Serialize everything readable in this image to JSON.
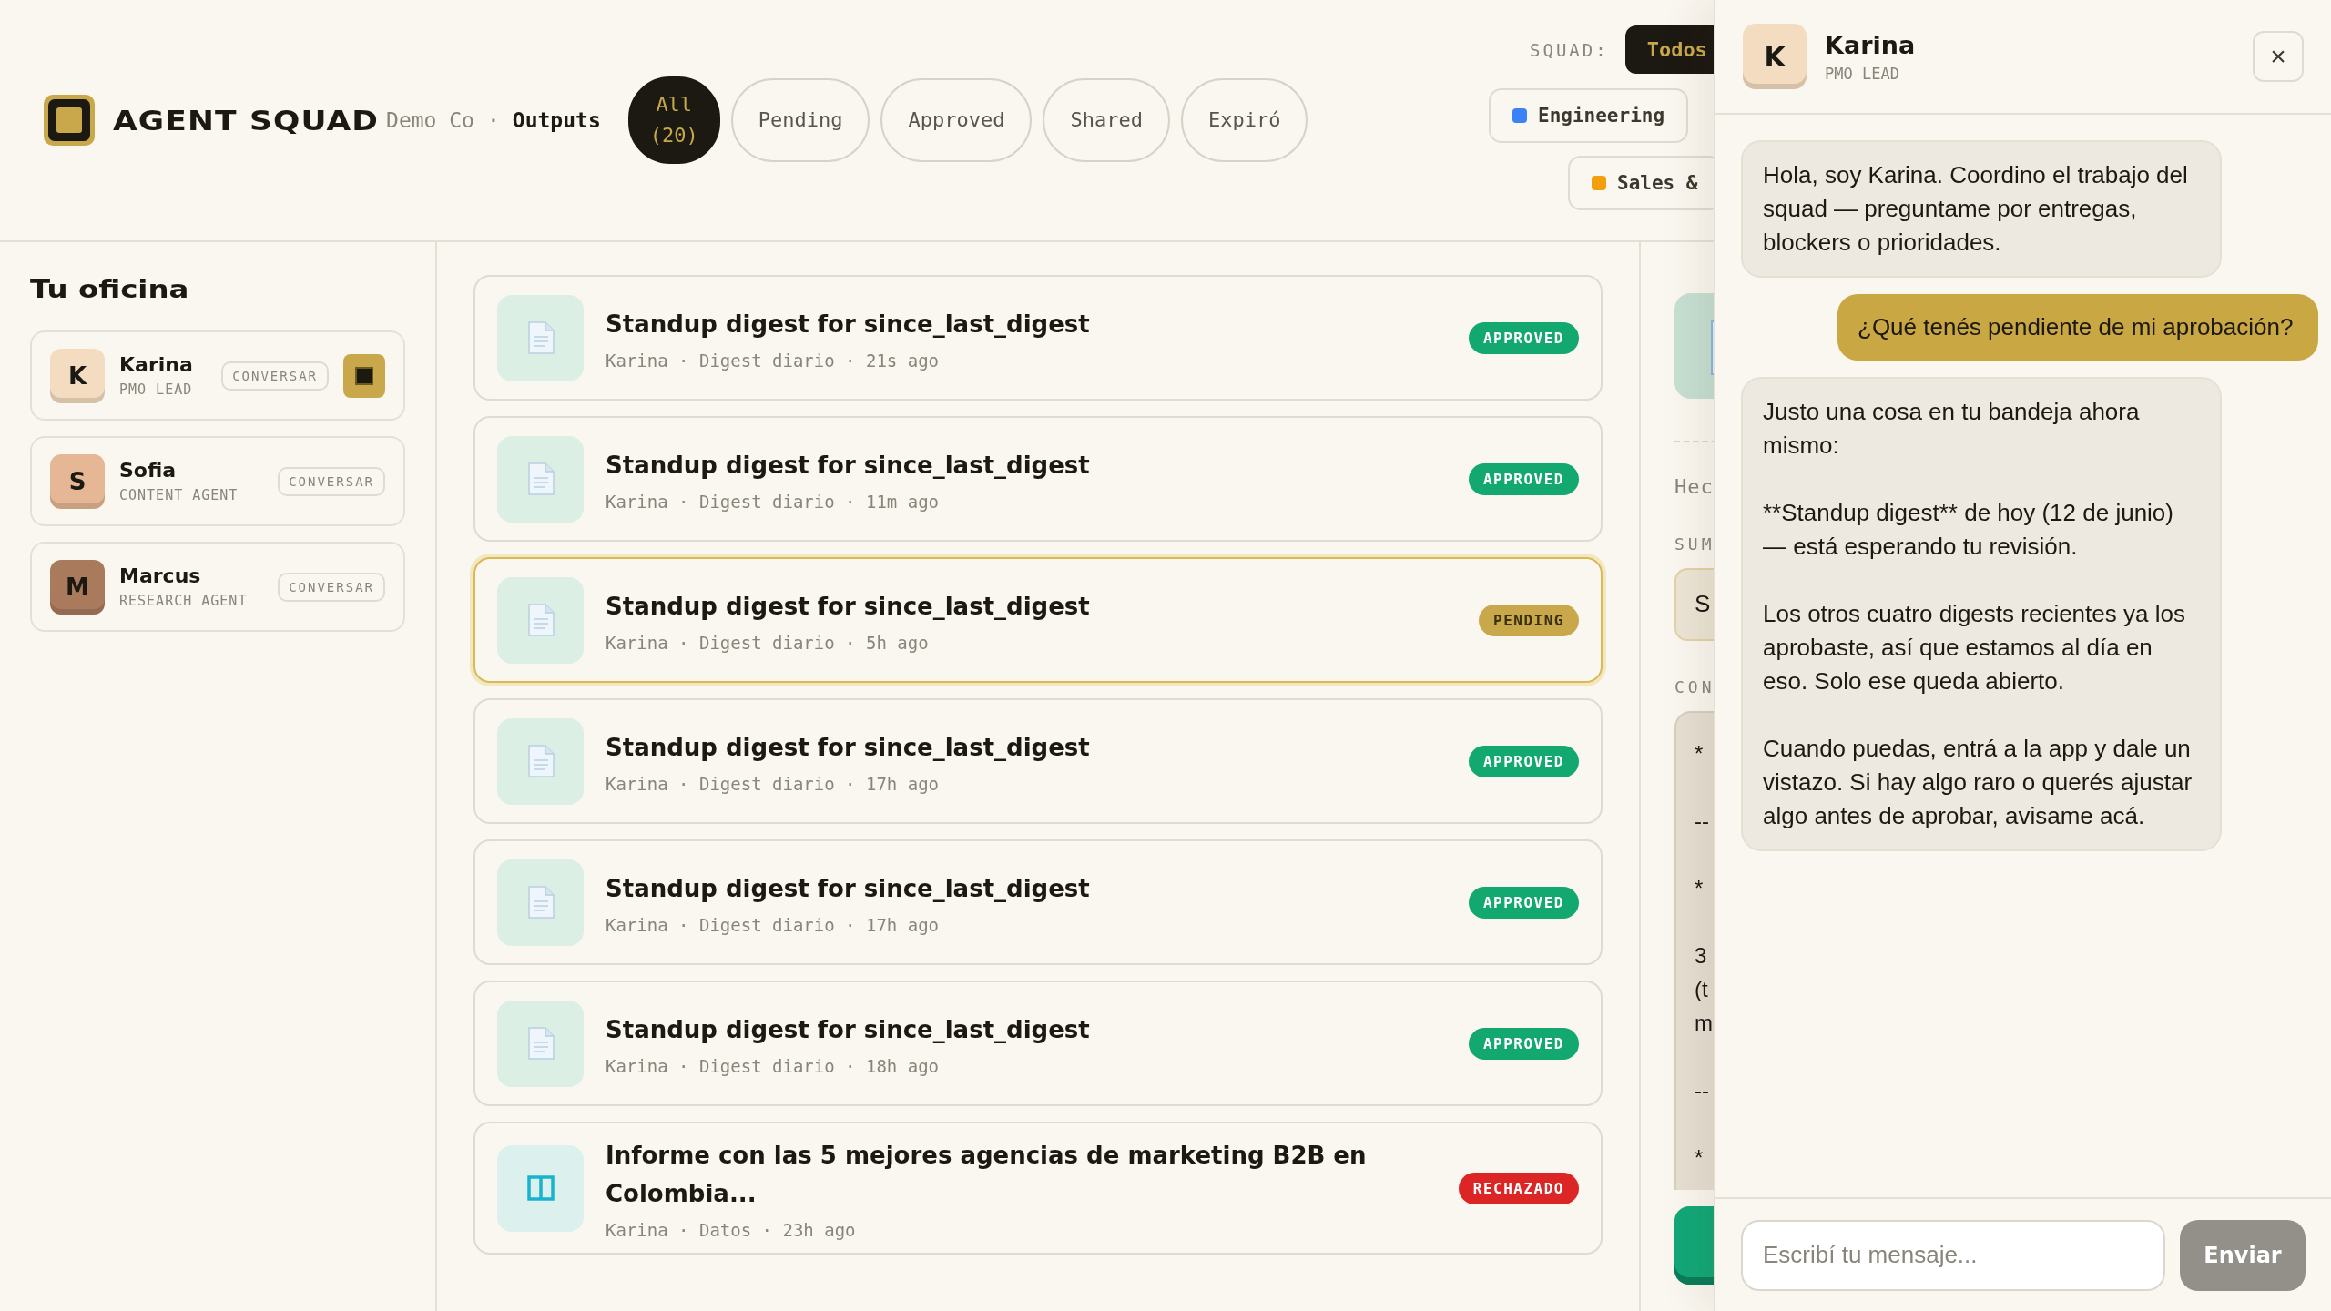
{
  "brand": {
    "name": "AGENT SQUAD",
    "org": "Demo Co",
    "separator": "·",
    "page": "Outputs"
  },
  "filters": [
    {
      "label": "All (20)",
      "selected": true
    },
    {
      "label": "Pending",
      "selected": false
    },
    {
      "label": "Approved",
      "selected": false
    },
    {
      "label": "Shared",
      "selected": false
    },
    {
      "label": "Expiró",
      "selected": false
    }
  ],
  "squad": {
    "label": "SQUAD:",
    "options": [
      {
        "label": "Todos",
        "selected": true
      }
    ],
    "teams": [
      {
        "label": "Engineering",
        "color": "#3b82f6"
      },
      {
        "label": "Sales &",
        "color": "#f59e0b"
      }
    ]
  },
  "sidebar": {
    "title": "Tu oficina",
    "agents": [
      {
        "initial": "K",
        "name": "Karina",
        "role": "PMO LEAD",
        "action": "CONVERSAR",
        "color": "#f4dcc0",
        "active": true
      },
      {
        "initial": "S",
        "name": "Sofia",
        "role": "CONTENT AGENT",
        "action": "CONVERSAR",
        "color": "#e6b795",
        "active": false
      },
      {
        "initial": "M",
        "name": "Marcus",
        "role": "RESEARCH AGENT",
        "action": "CONVERSAR",
        "color": "#a97a5c",
        "active": false
      }
    ]
  },
  "outputs": [
    {
      "kind": "document",
      "title": "Standup digest for since_last_digest",
      "meta": "Karina · Digest diario · 21s ago",
      "status": "APPROVED",
      "color": "#12a870",
      "selected": false
    },
    {
      "kind": "document",
      "title": "Standup digest for since_last_digest",
      "meta": "Karina · Digest diario · 11m ago",
      "status": "APPROVED",
      "color": "#12a870",
      "selected": false
    },
    {
      "kind": "document",
      "title": "Standup digest for since_last_digest",
      "meta": "Karina · Digest diario · 5h ago",
      "status": "PENDING",
      "color": "#c9a84c",
      "selected": true
    },
    {
      "kind": "document",
      "title": "Standup digest for since_last_digest",
      "meta": "Karina · Digest diario · 17h ago",
      "status": "APPROVED",
      "color": "#12a870",
      "selected": false
    },
    {
      "kind": "document",
      "title": "Standup digest for since_last_digest",
      "meta": "Karina · Digest diario · 17h ago",
      "status": "APPROVED",
      "color": "#12a870",
      "selected": false
    },
    {
      "kind": "document",
      "title": "Standup digest for since_last_digest",
      "meta": "Karina · Digest diario · 18h ago",
      "status": "APPROVED",
      "color": "#12a870",
      "selected": false
    },
    {
      "kind": "table",
      "title": "Informe con las 5 mejores agencias de marketing B2B en Colombia...",
      "meta": "Karina · Datos · 23h ago",
      "status": "RECHAZADO",
      "color": "#dc2626",
      "selected": false
    }
  ],
  "detail": {
    "label": "Hec",
    "summary_label": "SUM",
    "summary": "S",
    "content_label": "CON",
    "content": "*\n\n--\n\n*\n\n3\n(t\nm\n\n--\n\n*"
  },
  "chat": {
    "initial": "K",
    "name": "Karina",
    "role": "PMO LEAD",
    "color": "#f4dcc0",
    "close": "×",
    "messages": [
      {
        "kind": "agent",
        "text": "Hola, soy Karina. Coordino el trabajo del squad — preguntame por entregas, blockers o prioridades."
      },
      {
        "kind": "user",
        "text": "¿Qué tenés pendiente de mi aprobación?"
      },
      {
        "kind": "agent",
        "text": "Justo una cosa en tu bandeja ahora mismo:\n\n**Standup digest** de hoy (12 de junio) — está esperando tu revisión.\n\nLos otros cuatro digests recientes ya los aprobaste, así que estamos al día en eso. Solo ese queda abierto.\n\nCuando puedas, entrá a la app y dale un vistazo. Si hay algo raro o querés ajustar algo antes de aprobar, avisame acá."
      }
    ],
    "input": {
      "placeholder": "Escribí tu mensaje..."
    },
    "send": "Enviar"
  }
}
